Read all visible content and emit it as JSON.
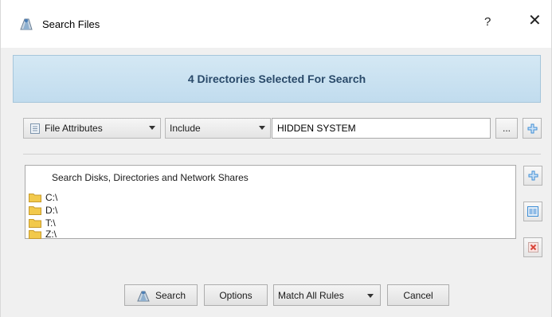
{
  "window": {
    "title": "Search Files",
    "help": "?",
    "close": "✕"
  },
  "banner": {
    "text": "4 Directories Selected For Search"
  },
  "rule": {
    "attribute_label": "File Attributes",
    "mode_label": "Include",
    "value": "HIDDEN SYSTEM",
    "browse_label": "..."
  },
  "locations": {
    "header": "Search Disks, Directories and Network Shares",
    "items": [
      "C:\\",
      "D:\\",
      "T:\\",
      "Z:\\"
    ]
  },
  "buttons": {
    "search": "Search",
    "options": "Options",
    "match": "Match All Rules",
    "cancel": "Cancel"
  },
  "colors": {
    "banner_bg": "#c8e1f1",
    "banner_text": "#2a4a6a",
    "folder": "#f2c94c",
    "plus_icon": "#3d8ed6",
    "remove_icon": "#d9463b"
  },
  "icons": {
    "app": "magnifier-icon",
    "attr": "file-attributes-icon",
    "add": "plus-icon",
    "edit": "edit-list-icon",
    "remove": "remove-icon",
    "folder": "folder-icon"
  }
}
